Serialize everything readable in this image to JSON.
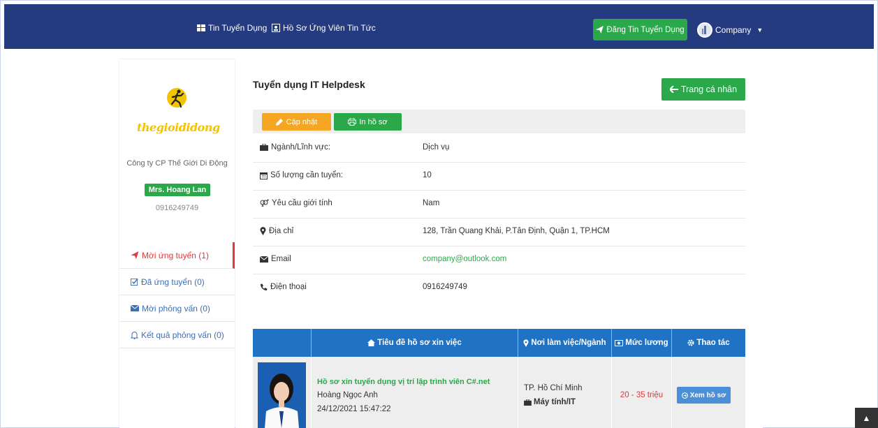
{
  "nav": {
    "links": [
      {
        "label": "Tin Tuyển Dụng",
        "icon": "grid-icon"
      },
      {
        "label": "Hồ Sơ Ứng Viên",
        "icon": "id-card-icon"
      },
      {
        "label": "Tin Tức"
      }
    ],
    "post_button": "Đăng Tin Tuyển Dụng",
    "account_label": "Company"
  },
  "sidebar": {
    "logo_text": "thegioididong",
    "company_name": "Công ty CP Thế Giới Di Động",
    "contact_name": "Mrs. Hoang Lan",
    "phone": "0916249749",
    "menu": [
      {
        "label": "Mời ứng tuyển (1)",
        "icon": "paper-plane-icon",
        "active": true
      },
      {
        "label": "Đã ứng tuyển (0)",
        "icon": "check-square-icon"
      },
      {
        "label": "Mời phỏng vấn (0)",
        "icon": "envelope-icon"
      },
      {
        "label": "Kết quả phỏng vấn (0)",
        "icon": "bell-icon"
      }
    ]
  },
  "main": {
    "job_title": "Tuyển dụng IT Helpdesk",
    "back_button": "Trang cá nhân",
    "update_button": "Cập nhật",
    "print_button": "In hồ sơ",
    "info": [
      {
        "label": "Ngành/Lĩnh vực:",
        "value": "Dịch vụ",
        "icon": "briefcase-icon"
      },
      {
        "label": "Số lượng cần tuyển:",
        "value": "10",
        "icon": "calendar-icon"
      },
      {
        "label": "Yêu cầu giới tính",
        "value": "Nam",
        "icon": "gender-icon"
      },
      {
        "label": "Địa chỉ",
        "value": "128, Trần Quang Khải, P.Tân Định, Quận 1, TP.HCM",
        "icon": "map-marker-icon"
      },
      {
        "label": "Email",
        "value": "company@outlook.com",
        "icon": "envelope-icon"
      },
      {
        "label": "Điện thoại",
        "value": "0916249749",
        "icon": "phone-icon"
      }
    ],
    "table": {
      "headers": [
        "Tiêu đề hồ sơ xin việc",
        "Nơi làm việc/Ngành",
        "Mức lương",
        "Thao tác"
      ],
      "rows": [
        {
          "cv_title": "Hồ sơ xin tuyển dụng vị trí lập trình viên C#.net",
          "candidate": "Hoàng Ngọc Anh",
          "date": "24/12/2021 15:47:22",
          "city": "TP. Hồ Chí Minh",
          "industry": "Máy tính/IT",
          "salary": "20 - 35 triệu",
          "action": "Xem hồ sơ"
        }
      ]
    }
  },
  "colors": {
    "nav_bg": "#253b80",
    "green": "#2aa84a",
    "orange": "#f5a623",
    "table_header": "#1f72c4",
    "danger": "#e0383e"
  }
}
